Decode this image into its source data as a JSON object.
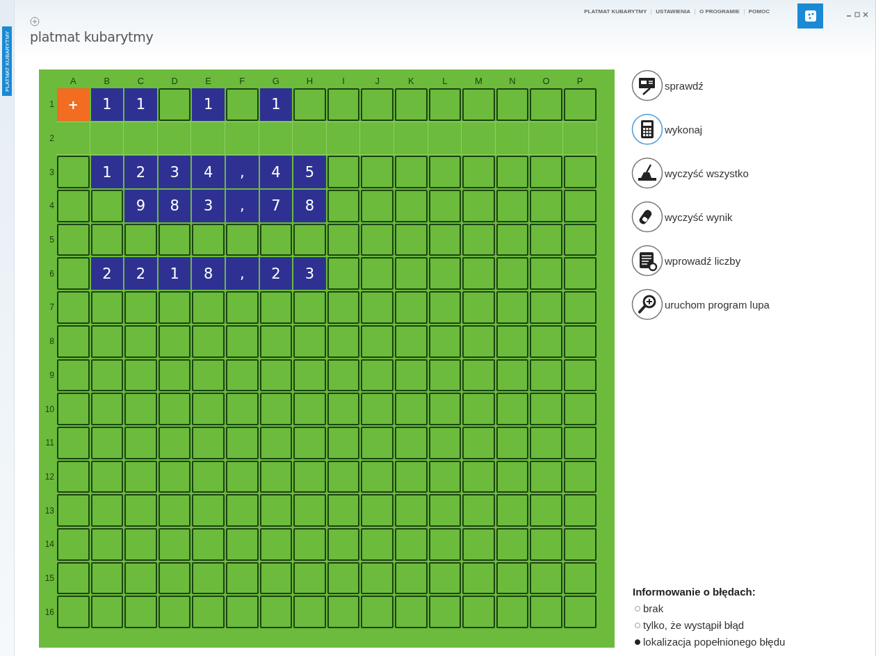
{
  "menu": [
    {
      "label": "PLATMAT KUBARYTMY"
    },
    {
      "label": "USTAWIENIA"
    },
    {
      "label": "O PROGRAMIE"
    },
    {
      "label": "POMOC"
    }
  ],
  "sidebar_tab": {
    "label": "PLATMAT KUBARYTMY"
  },
  "title": "platmat kubarytmy",
  "grid": {
    "columns": [
      "A",
      "B",
      "C",
      "D",
      "E",
      "F",
      "G",
      "H",
      "I",
      "J",
      "K",
      "L",
      "M",
      "N",
      "O",
      "P"
    ],
    "rows": [
      {
        "label": "1",
        "kind": "normal",
        "cells": [
          {
            "kind": "sign",
            "text": "+"
          },
          {
            "kind": "digit",
            "text": "1"
          },
          {
            "kind": "digit",
            "text": "1"
          },
          {
            "kind": "empty"
          },
          {
            "kind": "digit",
            "text": "1"
          },
          {
            "kind": "empty"
          },
          {
            "kind": "digit",
            "text": "1"
          },
          {
            "kind": "empty"
          },
          {
            "kind": "empty"
          },
          {
            "kind": "empty"
          },
          {
            "kind": "empty"
          },
          {
            "kind": "empty"
          },
          {
            "kind": "empty"
          },
          {
            "kind": "empty"
          },
          {
            "kind": "empty"
          },
          {
            "kind": "empty"
          }
        ]
      },
      {
        "label": "2",
        "kind": "separator",
        "cells": [
          {
            "kind": "empty"
          },
          {
            "kind": "empty"
          },
          {
            "kind": "empty"
          },
          {
            "kind": "empty"
          },
          {
            "kind": "empty"
          },
          {
            "kind": "empty"
          },
          {
            "kind": "empty"
          },
          {
            "kind": "empty"
          },
          {
            "kind": "empty"
          },
          {
            "kind": "empty"
          },
          {
            "kind": "empty"
          },
          {
            "kind": "empty"
          },
          {
            "kind": "empty"
          },
          {
            "kind": "empty"
          },
          {
            "kind": "empty"
          },
          {
            "kind": "empty"
          }
        ]
      },
      {
        "label": "3",
        "kind": "normal",
        "cells": [
          {
            "kind": "empty"
          },
          {
            "kind": "digit",
            "text": "1"
          },
          {
            "kind": "digit",
            "text": "2"
          },
          {
            "kind": "digit",
            "text": "3"
          },
          {
            "kind": "digit",
            "text": "4"
          },
          {
            "kind": "digit",
            "text": ","
          },
          {
            "kind": "digit",
            "text": "4"
          },
          {
            "kind": "digit",
            "text": "5"
          },
          {
            "kind": "empty"
          },
          {
            "kind": "empty"
          },
          {
            "kind": "empty"
          },
          {
            "kind": "empty"
          },
          {
            "kind": "empty"
          },
          {
            "kind": "empty"
          },
          {
            "kind": "empty"
          },
          {
            "kind": "empty"
          }
        ]
      },
      {
        "label": "4",
        "kind": "normal",
        "cells": [
          {
            "kind": "empty"
          },
          {
            "kind": "empty"
          },
          {
            "kind": "digit",
            "text": "9"
          },
          {
            "kind": "digit",
            "text": "8"
          },
          {
            "kind": "digit",
            "text": "3"
          },
          {
            "kind": "digit",
            "text": ","
          },
          {
            "kind": "digit",
            "text": "7"
          },
          {
            "kind": "digit",
            "text": "8"
          },
          {
            "kind": "empty"
          },
          {
            "kind": "empty"
          },
          {
            "kind": "empty"
          },
          {
            "kind": "empty"
          },
          {
            "kind": "empty"
          },
          {
            "kind": "empty"
          },
          {
            "kind": "empty"
          },
          {
            "kind": "empty"
          }
        ]
      },
      {
        "label": "5",
        "kind": "normal",
        "cells": [
          {
            "kind": "empty"
          },
          {
            "kind": "empty"
          },
          {
            "kind": "empty"
          },
          {
            "kind": "empty"
          },
          {
            "kind": "empty"
          },
          {
            "kind": "empty"
          },
          {
            "kind": "empty"
          },
          {
            "kind": "empty"
          },
          {
            "kind": "empty"
          },
          {
            "kind": "empty"
          },
          {
            "kind": "empty"
          },
          {
            "kind": "empty"
          },
          {
            "kind": "empty"
          },
          {
            "kind": "empty"
          },
          {
            "kind": "empty"
          },
          {
            "kind": "empty"
          }
        ]
      },
      {
        "label": "6",
        "kind": "normal",
        "cells": [
          {
            "kind": "empty"
          },
          {
            "kind": "digit",
            "text": "2"
          },
          {
            "kind": "digit",
            "text": "2"
          },
          {
            "kind": "digit",
            "text": "1"
          },
          {
            "kind": "digit",
            "text": "8"
          },
          {
            "kind": "digit",
            "text": ","
          },
          {
            "kind": "digit",
            "text": "2"
          },
          {
            "kind": "digit",
            "text": "3"
          },
          {
            "kind": "empty"
          },
          {
            "kind": "empty"
          },
          {
            "kind": "empty"
          },
          {
            "kind": "empty"
          },
          {
            "kind": "empty"
          },
          {
            "kind": "empty"
          },
          {
            "kind": "empty"
          },
          {
            "kind": "empty"
          }
        ]
      },
      {
        "label": "7",
        "kind": "normal",
        "cells": [
          {
            "kind": "empty"
          },
          {
            "kind": "empty"
          },
          {
            "kind": "empty"
          },
          {
            "kind": "empty"
          },
          {
            "kind": "empty"
          },
          {
            "kind": "empty"
          },
          {
            "kind": "empty"
          },
          {
            "kind": "empty"
          },
          {
            "kind": "empty"
          },
          {
            "kind": "empty"
          },
          {
            "kind": "empty"
          },
          {
            "kind": "empty"
          },
          {
            "kind": "empty"
          },
          {
            "kind": "empty"
          },
          {
            "kind": "empty"
          },
          {
            "kind": "empty"
          }
        ]
      },
      {
        "label": "8",
        "kind": "normal",
        "cells": [
          {
            "kind": "empty"
          },
          {
            "kind": "empty"
          },
          {
            "kind": "empty"
          },
          {
            "kind": "empty"
          },
          {
            "kind": "empty"
          },
          {
            "kind": "empty"
          },
          {
            "kind": "empty"
          },
          {
            "kind": "empty"
          },
          {
            "kind": "empty"
          },
          {
            "kind": "empty"
          },
          {
            "kind": "empty"
          },
          {
            "kind": "empty"
          },
          {
            "kind": "empty"
          },
          {
            "kind": "empty"
          },
          {
            "kind": "empty"
          },
          {
            "kind": "empty"
          }
        ]
      },
      {
        "label": "9",
        "kind": "normal",
        "cells": [
          {
            "kind": "empty"
          },
          {
            "kind": "empty"
          },
          {
            "kind": "empty"
          },
          {
            "kind": "empty"
          },
          {
            "kind": "empty"
          },
          {
            "kind": "empty"
          },
          {
            "kind": "empty"
          },
          {
            "kind": "empty"
          },
          {
            "kind": "empty"
          },
          {
            "kind": "empty"
          },
          {
            "kind": "empty"
          },
          {
            "kind": "empty"
          },
          {
            "kind": "empty"
          },
          {
            "kind": "empty"
          },
          {
            "kind": "empty"
          },
          {
            "kind": "empty"
          }
        ]
      },
      {
        "label": "10",
        "kind": "normal",
        "cells": [
          {
            "kind": "empty"
          },
          {
            "kind": "empty"
          },
          {
            "kind": "empty"
          },
          {
            "kind": "empty"
          },
          {
            "kind": "empty"
          },
          {
            "kind": "empty"
          },
          {
            "kind": "empty"
          },
          {
            "kind": "empty"
          },
          {
            "kind": "empty"
          },
          {
            "kind": "empty"
          },
          {
            "kind": "empty"
          },
          {
            "kind": "empty"
          },
          {
            "kind": "empty"
          },
          {
            "kind": "empty"
          },
          {
            "kind": "empty"
          },
          {
            "kind": "empty"
          }
        ]
      },
      {
        "label": "11",
        "kind": "normal",
        "cells": [
          {
            "kind": "empty"
          },
          {
            "kind": "empty"
          },
          {
            "kind": "empty"
          },
          {
            "kind": "empty"
          },
          {
            "kind": "empty"
          },
          {
            "kind": "empty"
          },
          {
            "kind": "empty"
          },
          {
            "kind": "empty"
          },
          {
            "kind": "empty"
          },
          {
            "kind": "empty"
          },
          {
            "kind": "empty"
          },
          {
            "kind": "empty"
          },
          {
            "kind": "empty"
          },
          {
            "kind": "empty"
          },
          {
            "kind": "empty"
          },
          {
            "kind": "empty"
          }
        ]
      },
      {
        "label": "12",
        "kind": "normal",
        "cells": [
          {
            "kind": "empty"
          },
          {
            "kind": "empty"
          },
          {
            "kind": "empty"
          },
          {
            "kind": "empty"
          },
          {
            "kind": "empty"
          },
          {
            "kind": "empty"
          },
          {
            "kind": "empty"
          },
          {
            "kind": "empty"
          },
          {
            "kind": "empty"
          },
          {
            "kind": "empty"
          },
          {
            "kind": "empty"
          },
          {
            "kind": "empty"
          },
          {
            "kind": "empty"
          },
          {
            "kind": "empty"
          },
          {
            "kind": "empty"
          },
          {
            "kind": "empty"
          }
        ]
      },
      {
        "label": "13",
        "kind": "normal",
        "cells": [
          {
            "kind": "empty"
          },
          {
            "kind": "empty"
          },
          {
            "kind": "empty"
          },
          {
            "kind": "empty"
          },
          {
            "kind": "empty"
          },
          {
            "kind": "empty"
          },
          {
            "kind": "empty"
          },
          {
            "kind": "empty"
          },
          {
            "kind": "empty"
          },
          {
            "kind": "empty"
          },
          {
            "kind": "empty"
          },
          {
            "kind": "empty"
          },
          {
            "kind": "empty"
          },
          {
            "kind": "empty"
          },
          {
            "kind": "empty"
          },
          {
            "kind": "empty"
          }
        ]
      },
      {
        "label": "14",
        "kind": "normal",
        "cells": [
          {
            "kind": "empty"
          },
          {
            "kind": "empty"
          },
          {
            "kind": "empty"
          },
          {
            "kind": "empty"
          },
          {
            "kind": "empty"
          },
          {
            "kind": "empty"
          },
          {
            "kind": "empty"
          },
          {
            "kind": "empty"
          },
          {
            "kind": "empty"
          },
          {
            "kind": "empty"
          },
          {
            "kind": "empty"
          },
          {
            "kind": "empty"
          },
          {
            "kind": "empty"
          },
          {
            "kind": "empty"
          },
          {
            "kind": "empty"
          },
          {
            "kind": "empty"
          }
        ]
      },
      {
        "label": "15",
        "kind": "normal",
        "cells": [
          {
            "kind": "empty"
          },
          {
            "kind": "empty"
          },
          {
            "kind": "empty"
          },
          {
            "kind": "empty"
          },
          {
            "kind": "empty"
          },
          {
            "kind": "empty"
          },
          {
            "kind": "empty"
          },
          {
            "kind": "empty"
          },
          {
            "kind": "empty"
          },
          {
            "kind": "empty"
          },
          {
            "kind": "empty"
          },
          {
            "kind": "empty"
          },
          {
            "kind": "empty"
          },
          {
            "kind": "empty"
          },
          {
            "kind": "empty"
          },
          {
            "kind": "empty"
          }
        ]
      },
      {
        "label": "16",
        "kind": "normal",
        "cells": [
          {
            "kind": "empty"
          },
          {
            "kind": "empty"
          },
          {
            "kind": "empty"
          },
          {
            "kind": "empty"
          },
          {
            "kind": "empty"
          },
          {
            "kind": "empty"
          },
          {
            "kind": "empty"
          },
          {
            "kind": "empty"
          },
          {
            "kind": "empty"
          },
          {
            "kind": "empty"
          },
          {
            "kind": "empty"
          },
          {
            "kind": "empty"
          },
          {
            "kind": "empty"
          },
          {
            "kind": "empty"
          },
          {
            "kind": "empty"
          },
          {
            "kind": "empty"
          }
        ]
      }
    ]
  },
  "actions": [
    {
      "label": "sprawdź",
      "kind": "check",
      "selected": false
    },
    {
      "label": "wykonaj",
      "kind": "calculator",
      "selected": true
    },
    {
      "label": "wyczyść wszystko",
      "kind": "broom",
      "selected": false
    },
    {
      "label": "wyczyść wynik",
      "kind": "eraser",
      "selected": false
    },
    {
      "label": "wprowadź liczby",
      "kind": "list",
      "selected": false
    },
    {
      "label": "uruchom program lupa",
      "kind": "magnifier",
      "selected": false
    }
  ],
  "error_reporting": {
    "title": "Informowanie o błędach:",
    "options": [
      {
        "label": "brak",
        "selected": false
      },
      {
        "label": "tylko, że wystąpił błąd",
        "selected": false
      },
      {
        "label": "lokalizacja popełnionego błędu",
        "selected": true
      }
    ]
  }
}
